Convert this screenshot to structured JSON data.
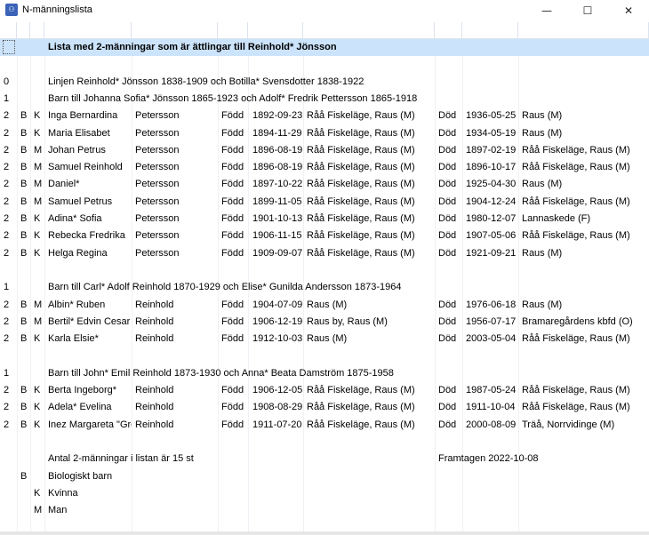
{
  "window": {
    "title": "N-männingslista",
    "app_icon": "family-tree-icon",
    "min_glyph": "—",
    "max_glyph": "☐",
    "close_glyph": "✕"
  },
  "list": {
    "heading": "Lista med 2-männingar som är ättlingar till Reinhold* Jönsson",
    "lineage": {
      "level": "0",
      "text": "Linjen Reinhold* Jönsson 1838-1909 och Botilla* Svensdotter 1838-1922"
    },
    "groups": [
      {
        "level": "1",
        "title": "Barn till Johanna Sofia* Jönsson 1865-1923 och Adolf* Fredrik Pettersson 1865-1918",
        "rows": [
          {
            "lvl": "2",
            "b": "B",
            "sex": "K",
            "first": "Inga Bernardina",
            "last": "Petersson",
            "born_lbl": "Född",
            "born": "1892-09-23",
            "born_place": "Råå Fiskeläge, Raus (M)",
            "died_lbl": "Död",
            "died": "1936-05-25",
            "died_place": "Raus (M)"
          },
          {
            "lvl": "2",
            "b": "B",
            "sex": "K",
            "first": "Maria Elisabet",
            "last": "Petersson",
            "born_lbl": "Född",
            "born": "1894-11-29",
            "born_place": "Råå Fiskeläge, Raus (M)",
            "died_lbl": "Död",
            "died": "1934-05-19",
            "died_place": "Raus (M)"
          },
          {
            "lvl": "2",
            "b": "B",
            "sex": "M",
            "first": "Johan Petrus",
            "last": "Petersson",
            "born_lbl": "Född",
            "born": "1896-08-19",
            "born_place": "Råå Fiskeläge, Raus (M)",
            "died_lbl": "Död",
            "died": "1897-02-19",
            "died_place": "Råå Fiskeläge, Raus (M)"
          },
          {
            "lvl": "2",
            "b": "B",
            "sex": "M",
            "first": "Samuel Reinhold",
            "last": "Petersson",
            "born_lbl": "Född",
            "born": "1896-08-19",
            "born_place": "Råå Fiskeläge, Raus (M)",
            "died_lbl": "Död",
            "died": "1896-10-17",
            "died_place": "Råå Fiskeläge, Raus (M)"
          },
          {
            "lvl": "2",
            "b": "B",
            "sex": "M",
            "first": "Daniel*",
            "last": "Petersson",
            "born_lbl": "Född",
            "born": "1897-10-22",
            "born_place": "Råå Fiskeläge, Raus (M)",
            "died_lbl": "Död",
            "died": "1925-04-30",
            "died_place": "Raus (M)"
          },
          {
            "lvl": "2",
            "b": "B",
            "sex": "M",
            "first": "Samuel Petrus",
            "last": "Petersson",
            "born_lbl": "Född",
            "born": "1899-11-05",
            "born_place": "Råå Fiskeläge, Raus (M)",
            "died_lbl": "Död",
            "died": "1904-12-24",
            "died_place": "Råå Fiskeläge, Raus (M)"
          },
          {
            "lvl": "2",
            "b": "B",
            "sex": "K",
            "first": "Adina* Sofia",
            "last": "Petersson",
            "born_lbl": "Född",
            "born": "1901-10-13",
            "born_place": "Råå Fiskeläge, Raus (M)",
            "died_lbl": "Död",
            "died": "1980-12-07",
            "died_place": "Lannaskede (F)"
          },
          {
            "lvl": "2",
            "b": "B",
            "sex": "K",
            "first": "Rebecka Fredrika",
            "last": "Petersson",
            "born_lbl": "Född",
            "born": "1906-11-15",
            "born_place": "Råå Fiskeläge, Raus (M)",
            "died_lbl": "Död",
            "died": "1907-05-06",
            "died_place": "Råå Fiskeläge, Raus (M)"
          },
          {
            "lvl": "2",
            "b": "B",
            "sex": "K",
            "first": "Helga Regina",
            "last": "Petersson",
            "born_lbl": "Född",
            "born": "1909-09-07",
            "born_place": "Råå Fiskeläge, Raus (M)",
            "died_lbl": "Död",
            "died": "1921-09-21",
            "died_place": "Raus (M)"
          }
        ]
      },
      {
        "level": "1",
        "title": "Barn till Carl* Adolf Reinhold 1870-1929 och Elise* Gunilda Andersson 1873-1964",
        "rows": [
          {
            "lvl": "2",
            "b": "B",
            "sex": "M",
            "first": "Albin* Ruben",
            "last": "Reinhold",
            "born_lbl": "Född",
            "born": "1904-07-09",
            "born_place": "Raus (M)",
            "died_lbl": "Död",
            "died": "1976-06-18",
            "died_place": "Raus (M)"
          },
          {
            "lvl": "2",
            "b": "B",
            "sex": "M",
            "first": "Bertil* Edvin Cesar",
            "last": "Reinhold",
            "born_lbl": "Född",
            "born": "1906-12-19",
            "born_place": "Raus by, Raus (M)",
            "died_lbl": "Död",
            "died": "1956-07-17",
            "died_place": "Bramaregårdens kbfd (O)"
          },
          {
            "lvl": "2",
            "b": "B",
            "sex": "K",
            "first": "Karla Elsie*",
            "last": "Reinhold",
            "born_lbl": "Född",
            "born": "1912-10-03",
            "born_place": "Raus (M)",
            "died_lbl": "Död",
            "died": "2003-05-04",
            "died_place": "Råå Fiskeläge, Raus (M)"
          }
        ]
      },
      {
        "level": "1",
        "title": "Barn till John* Emil Reinhold 1873-1930 och Anna* Beata Damström 1875-1958",
        "rows": [
          {
            "lvl": "2",
            "b": "B",
            "sex": "K",
            "first": "Berta Ingeborg*",
            "last": "Reinhold",
            "born_lbl": "Född",
            "born": "1906-12-05",
            "born_place": "Råå Fiskeläge, Raus (M)",
            "died_lbl": "Död",
            "died": "1987-05-24",
            "died_place": "Råå Fiskeläge, Raus (M)"
          },
          {
            "lvl": "2",
            "b": "B",
            "sex": "K",
            "first": "Adela* Evelina",
            "last": "Reinhold",
            "born_lbl": "Född",
            "born": "1908-08-29",
            "born_place": "Råå Fiskeläge, Raus (M)",
            "died_lbl": "Död",
            "died": "1911-10-04",
            "died_place": "Råå Fiskeläge, Raus (M)"
          },
          {
            "lvl": "2",
            "b": "B",
            "sex": "K",
            "first": "Inez Margareta \"Greta\"",
            "last": "Reinhold",
            "born_lbl": "Född",
            "born": "1911-07-20",
            "born_place": "Råå Fiskeläge, Raus (M)",
            "died_lbl": "Död",
            "died": "2000-08-09",
            "died_place": "Träå, Norrvidinge (M)"
          }
        ]
      }
    ],
    "summary": "Antal 2-männingar i listan är 15 st",
    "generated": "Framtagen 2022-10-08",
    "legend": [
      {
        "code": "B",
        "text": "Biologiskt barn"
      },
      {
        "code": "K",
        "text": "Kvinna"
      },
      {
        "code": "M",
        "text": "Man"
      }
    ]
  }
}
